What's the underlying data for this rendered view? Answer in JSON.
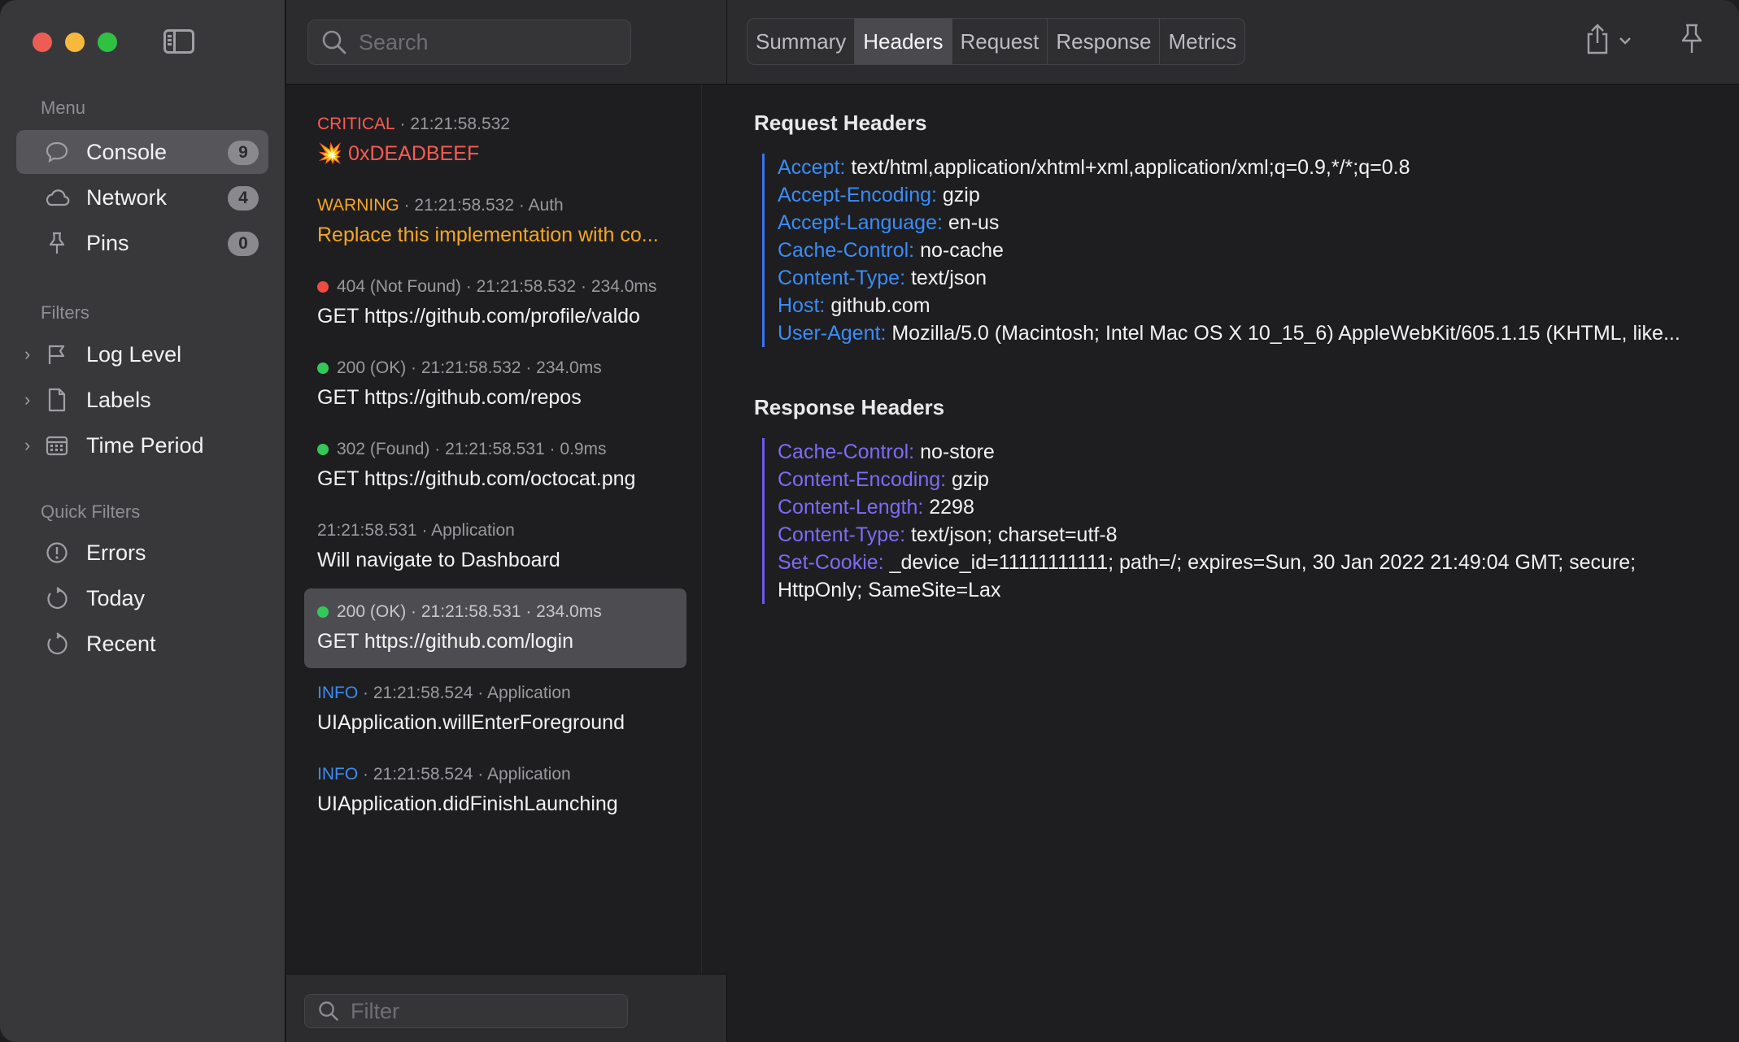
{
  "sidebar": {
    "menu_title": "Menu",
    "menu_items": [
      {
        "label": "Console",
        "badge": "9",
        "icon": "speech-bubble-icon"
      },
      {
        "label": "Network",
        "badge": "4",
        "icon": "cloud-icon"
      },
      {
        "label": "Pins",
        "badge": "0",
        "icon": "pin-icon"
      }
    ],
    "filters_title": "Filters",
    "filter_items": [
      {
        "label": "Log Level",
        "icon": "flag-icon"
      },
      {
        "label": "Labels",
        "icon": "document-icon"
      },
      {
        "label": "Time Period",
        "icon": "calendar-icon"
      }
    ],
    "quick_title": "Quick Filters",
    "quick_items": [
      {
        "label": "Errors",
        "icon": "exclamation-circle-icon"
      },
      {
        "label": "Today",
        "icon": "clock-arrow-icon"
      },
      {
        "label": "Recent",
        "icon": "clock-arrow-icon"
      }
    ]
  },
  "search": {
    "placeholder": "Search"
  },
  "filter": {
    "placeholder": "Filter"
  },
  "entries": [
    {
      "level": "CRITICAL",
      "meta": "· 21:21:58.532",
      "message": "💥 0xDEADBEEF"
    },
    {
      "level": "WARNING",
      "meta": "· 21:21:58.532 · Auth",
      "message": "Replace this implementation with co..."
    },
    {
      "status": "404 (Not Found)",
      "meta": "· 21:21:58.532 · 234.0ms",
      "message": "GET https://github.com/profile/valdo"
    },
    {
      "status": "200 (OK)",
      "meta": "· 21:21:58.532 · 234.0ms",
      "message": "GET https://github.com/repos"
    },
    {
      "status": "302 (Found)",
      "meta": "· 21:21:58.531 · 0.9ms",
      "message": "GET https://github.com/octocat.png"
    },
    {
      "meta": "21:21:58.531 · Application",
      "message": "Will navigate to Dashboard"
    },
    {
      "status": "200 (OK)",
      "meta": "· 21:21:58.531 · 234.0ms",
      "message": "GET https://github.com/login"
    },
    {
      "level": "INFO",
      "meta": "· 21:21:58.524 · Application",
      "message": "UIApplication.willEnterForeground"
    },
    {
      "level": "INFO",
      "meta": "· 21:21:58.524 · Application",
      "message": "UIApplication.didFinishLaunching"
    }
  ],
  "tabs": [
    "Summary",
    "Headers",
    "Request",
    "Response",
    "Metrics"
  ],
  "active_tab": "Headers",
  "request_headers": {
    "title": "Request Headers",
    "items": [
      {
        "key": "Accept:",
        "value": "text/html,application/xhtml+xml,application/xml;q=0.9,*/*;q=0.8"
      },
      {
        "key": "Accept-Encoding:",
        "value": "gzip"
      },
      {
        "key": "Accept-Language:",
        "value": "en-us"
      },
      {
        "key": "Cache-Control:",
        "value": "no-cache"
      },
      {
        "key": "Content-Type:",
        "value": "text/json"
      },
      {
        "key": "Host:",
        "value": "github.com"
      },
      {
        "key": "User-Agent:",
        "value": "Mozilla/5.0 (Macintosh; Intel Mac OS X 10_15_6) AppleWebKit/605.1.15 (KHTML, like..."
      }
    ]
  },
  "response_headers": {
    "title": "Response Headers",
    "items": [
      {
        "key": "Cache-Control:",
        "value": "no-store"
      },
      {
        "key": "Content-Encoding:",
        "value": "gzip"
      },
      {
        "key": "Content-Length:",
        "value": "2298"
      },
      {
        "key": "Content-Type:",
        "value": "text/json; charset=utf-8"
      },
      {
        "key": "Set-Cookie:",
        "value": "_device_id=11111111111; path=/; expires=Sun, 30 Jan 2022 21:49:04 GMT; secure; HttpOnly; SameSite=Lax"
      }
    ]
  },
  "colors": {
    "critical": "#ff5a52",
    "warning": "#f5a623",
    "info": "#3b8cf0",
    "status_error": "#ee4b43",
    "status_ok": "#34c759",
    "request_key": "#3b8cf7",
    "response_key": "#7b6cf6"
  }
}
